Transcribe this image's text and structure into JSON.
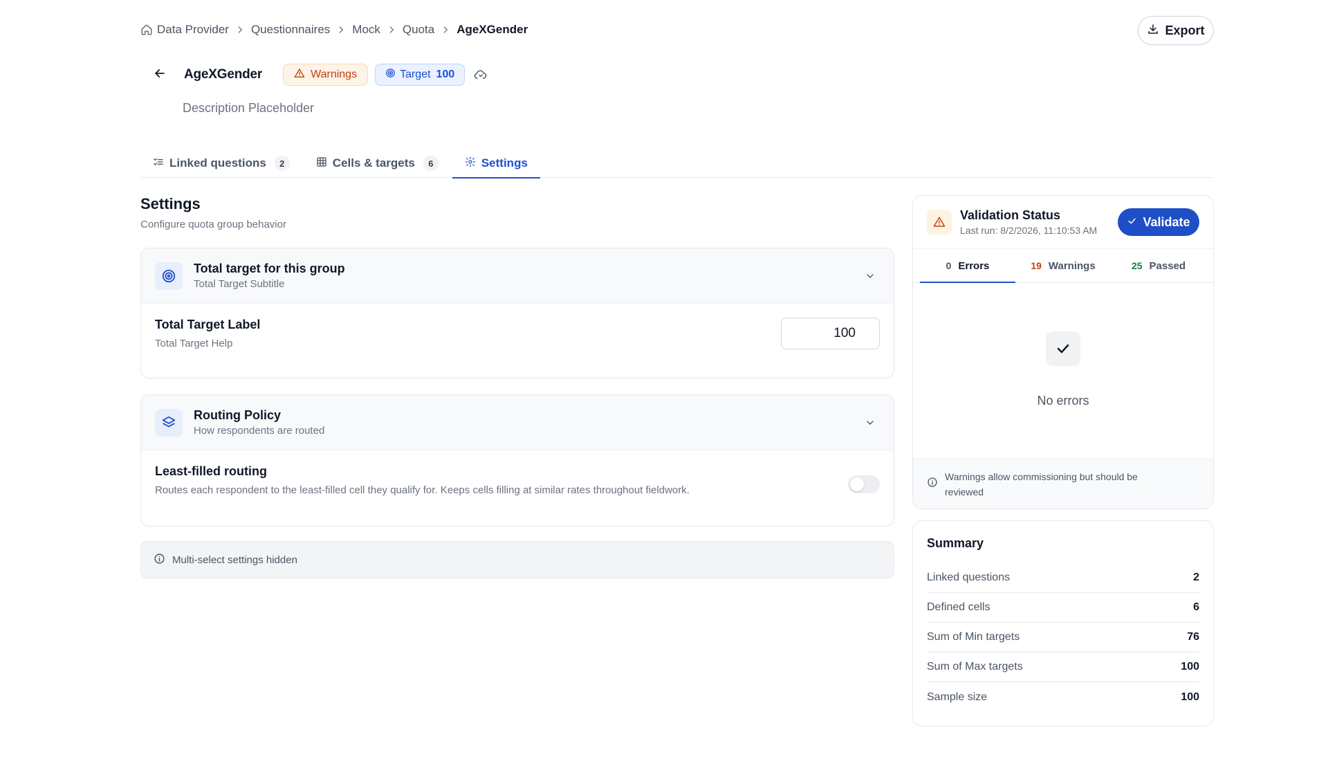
{
  "breadcrumb": {
    "items": [
      "Data Provider",
      "Questionnaires",
      "Mock",
      "Quota"
    ],
    "current": "AgeXGender"
  },
  "export_label": "Export",
  "header": {
    "title": "AgeXGender",
    "warnings_badge": "Warnings",
    "target_label": "Target",
    "target_value": "100",
    "description": "Description Placeholder"
  },
  "tabs": [
    {
      "label": "Linked questions",
      "count": "2"
    },
    {
      "label": "Cells & targets",
      "count": "6"
    },
    {
      "label": "Settings"
    }
  ],
  "settings": {
    "title": "Settings",
    "subtitle": "Configure quota group behavior",
    "total_target_card": {
      "title": "Total target for this group",
      "subtitle": "Total Target Subtitle",
      "field_label": "Total Target Label",
      "field_help": "Total Target Help",
      "value": "100"
    },
    "routing_card": {
      "title": "Routing Policy",
      "subtitle": "How respondents are routed",
      "option_label": "Least-filled routing",
      "option_help": "Routes each respondent to the least-filled cell they qualify for. Keeps cells filling at similar rates throughout fieldwork.",
      "enabled": false
    },
    "notice": "Multi-select settings hidden"
  },
  "validation": {
    "title": "Validation Status",
    "last_run": "Last run: 8/2/2026, 11:10:53 AM",
    "validate_label": "Validate",
    "tabs": [
      {
        "count": "0",
        "label": "Errors",
        "color": "#4b5563"
      },
      {
        "count": "19",
        "label": "Warnings",
        "color": "#c2410c"
      },
      {
        "count": "25",
        "label": "Passed",
        "color": "#15803d"
      }
    ],
    "empty_text": "No errors",
    "footer": "Warnings allow commissioning but should be reviewed"
  },
  "summary": {
    "title": "Summary",
    "rows": [
      {
        "label": "Linked questions",
        "value": "2"
      },
      {
        "label": "Defined cells",
        "value": "6"
      },
      {
        "label": "Sum of Min targets",
        "value": "76"
      },
      {
        "label": "Sum of Max targets",
        "value": "100"
      },
      {
        "label": "Sample size",
        "value": "100"
      }
    ]
  },
  "colors": {
    "accent": "#1e4fc7",
    "warning": "#c2410c",
    "success": "#15803d"
  }
}
